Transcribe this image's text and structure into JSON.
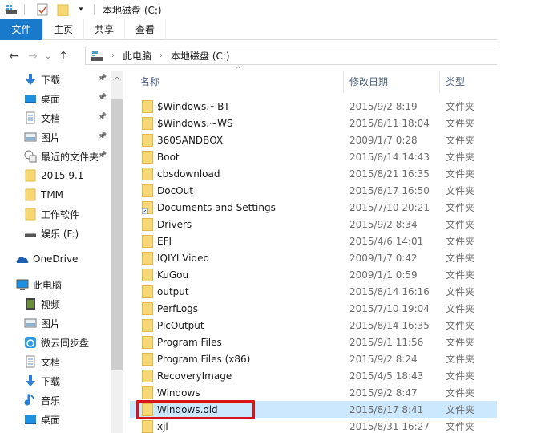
{
  "window": {
    "title": "本地磁盘 (C:)",
    "quick_access_icons": [
      "drive-icon",
      "properties-icon",
      "new-folder-icon",
      "customize-dropdown-icon"
    ]
  },
  "ribbon": {
    "tabs": [
      {
        "label": "文件",
        "active": true
      },
      {
        "label": "主页"
      },
      {
        "label": "共享"
      },
      {
        "label": "查看"
      }
    ]
  },
  "address": {
    "back_icon": "←",
    "forward_icon": "→",
    "recent_icon": "⌄",
    "up_icon": "↑",
    "breadcrumbs": [
      "此电脑",
      "本地磁盘 (C:)"
    ]
  },
  "nav": {
    "items": [
      {
        "label": "下载",
        "icon": "download-icon",
        "pinned": true
      },
      {
        "label": "桌面",
        "icon": "desktop-icon",
        "pinned": true
      },
      {
        "label": "文档",
        "icon": "document-icon",
        "pinned": true
      },
      {
        "label": "图片",
        "icon": "pictures-icon",
        "pinned": true
      },
      {
        "label": "最近的文件夹",
        "icon": "recent-folders-icon",
        "pinned": true
      },
      {
        "label": "2015.9.1",
        "icon": "folder-icon"
      },
      {
        "label": "TMM",
        "icon": "folder-icon"
      },
      {
        "label": "工作软件",
        "icon": "folder-icon"
      },
      {
        "label": "娱乐 (F:)",
        "icon": "drive-icon"
      },
      {
        "label": "OneDrive",
        "icon": "onedrive-icon"
      },
      {
        "label": "此电脑",
        "icon": "computer-icon"
      },
      {
        "label": "视频",
        "icon": "videos-icon"
      },
      {
        "label": "图片",
        "icon": "pictures-icon"
      },
      {
        "label": "微云同步盘",
        "icon": "weiyun-icon"
      },
      {
        "label": "文档",
        "icon": "document-icon"
      },
      {
        "label": "下载",
        "icon": "download-icon"
      },
      {
        "label": "音乐",
        "icon": "music-icon"
      },
      {
        "label": "桌面",
        "icon": "desktop-icon"
      }
    ]
  },
  "list": {
    "columns": {
      "name": "名称",
      "date": "修改日期",
      "type": "类型"
    },
    "rows": [
      {
        "name": "$Windows.~BT",
        "date": "2015/9/2 8:19",
        "type": "文件夹"
      },
      {
        "name": "$Windows.~WS",
        "date": "2015/8/11 18:04",
        "type": "文件夹"
      },
      {
        "name": "360SANDBOX",
        "date": "2009/1/7 0:28",
        "type": "文件夹"
      },
      {
        "name": "Boot",
        "date": "2015/8/14 14:43",
        "type": "文件夹"
      },
      {
        "name": "cbsdownload",
        "date": "2015/8/21 16:35",
        "type": "文件夹"
      },
      {
        "name": "DocOut",
        "date": "2015/8/17 16:50",
        "type": "文件夹"
      },
      {
        "name": "Documents and Settings",
        "date": "2015/7/10 20:21",
        "type": "文件夹",
        "shortcut": true
      },
      {
        "name": "Drivers",
        "date": "2015/9/2 8:34",
        "type": "文件夹"
      },
      {
        "name": "EFI",
        "date": "2015/4/6 14:01",
        "type": "文件夹"
      },
      {
        "name": "IQIYI Video",
        "date": "2009/1/7 0:42",
        "type": "文件夹"
      },
      {
        "name": "KuGou",
        "date": "2009/1/1 0:59",
        "type": "文件夹"
      },
      {
        "name": "output",
        "date": "2015/8/14 16:16",
        "type": "文件夹"
      },
      {
        "name": "PerfLogs",
        "date": "2015/7/10 19:04",
        "type": "文件夹"
      },
      {
        "name": "PicOutput",
        "date": "2015/8/14 16:35",
        "type": "文件夹"
      },
      {
        "name": "Program Files",
        "date": "2015/9/1 11:56",
        "type": "文件夹"
      },
      {
        "name": "Program Files (x86)",
        "date": "2015/9/2 8:24",
        "type": "文件夹"
      },
      {
        "name": "RecoveryImage",
        "date": "2015/4/5 18:43",
        "type": "文件夹"
      },
      {
        "name": "Windows",
        "date": "2015/9/2 8:47",
        "type": "文件夹"
      },
      {
        "name": "Windows.old",
        "date": "2015/8/17 8:41",
        "type": "文件夹",
        "selected": true
      },
      {
        "name": "xjl",
        "date": "2015/8/31 16:27",
        "type": "文件夹"
      }
    ]
  },
  "colors": {
    "accent": "#1979ca",
    "selection": "#cce8ff",
    "annotation": "#d8141b"
  }
}
